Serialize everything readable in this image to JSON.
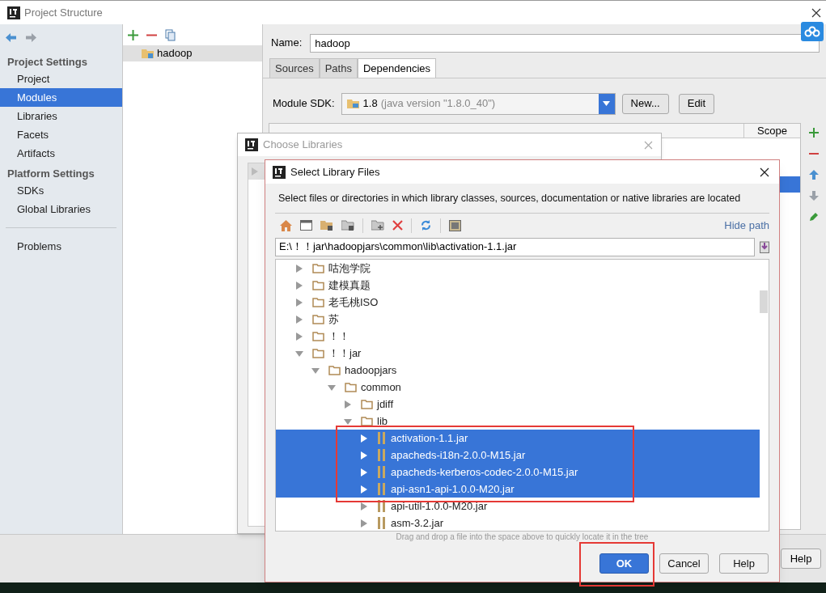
{
  "window": {
    "title": "Project Structure"
  },
  "sidebar": {
    "sections": [
      {
        "heading": "Project Settings",
        "items": [
          {
            "label": "Project",
            "selected": false
          },
          {
            "label": "Modules",
            "selected": true
          },
          {
            "label": "Libraries",
            "selected": false
          },
          {
            "label": "Facets",
            "selected": false
          },
          {
            "label": "Artifacts",
            "selected": false
          }
        ]
      },
      {
        "heading": "Platform Settings",
        "items": [
          {
            "label": "SDKs",
            "selected": false
          },
          {
            "label": "Global Libraries",
            "selected": false
          }
        ]
      }
    ],
    "footer_items": [
      {
        "label": "Problems",
        "selected": false
      }
    ]
  },
  "modules": {
    "items": [
      {
        "label": "hadoop",
        "selected": true
      }
    ]
  },
  "module_form": {
    "name_label": "Name:",
    "name_value": "hadoop",
    "tabs": [
      {
        "label": "Sources",
        "selected": false
      },
      {
        "label": "Paths",
        "selected": false
      },
      {
        "label": "Dependencies",
        "selected": true
      }
    ],
    "sdk_label": "Module SDK:",
    "sdk_value": "1.8",
    "sdk_detail": "(java version \"1.8.0_40\")",
    "buttons": [
      "New...",
      "Edit"
    ],
    "table": {
      "columns": [
        "Scope"
      ],
      "rows": [
        {
          "selected": true
        }
      ]
    }
  },
  "bottom_buttons": [
    "Help"
  ],
  "choose_dialog": {
    "title": "Choose Libraries"
  },
  "select_dialog": {
    "title": "Select Library Files",
    "description": "Select files or directories in which library classes, sources, documentation or native libraries are located",
    "hide_path": "Hide path",
    "path_value": "E:\\！！jar\\hadoopjars\\common\\lib\\activation-1.1.jar",
    "tree": [
      {
        "label": "咕泡学院",
        "kind": "folder",
        "expanded": false,
        "selected": false
      },
      {
        "label": "建模真题",
        "kind": "folder",
        "expanded": false,
        "selected": false
      },
      {
        "label": "老毛桃ISO",
        "kind": "folder",
        "expanded": false,
        "selected": false
      },
      {
        "label": "苏",
        "kind": "folder",
        "expanded": false,
        "selected": false
      },
      {
        "label": "！！",
        "kind": "folder",
        "expanded": false,
        "selected": false
      },
      {
        "label": "！！jar",
        "kind": "folder",
        "expanded": true,
        "selected": false,
        "children": [
          {
            "label": "hadoopjars",
            "kind": "folder",
            "expanded": true,
            "selected": false,
            "children": [
              {
                "label": "common",
                "kind": "folder",
                "expanded": true,
                "selected": false,
                "children": [
                  {
                    "label": "jdiff",
                    "kind": "folder",
                    "expanded": false,
                    "selected": false
                  },
                  {
                    "label": "lib",
                    "kind": "folder",
                    "expanded": true,
                    "selected": false,
                    "children": [
                      {
                        "label": "activation-1.1.jar",
                        "kind": "jar",
                        "expanded": false,
                        "selected": true
                      },
                      {
                        "label": "apacheds-i18n-2.0.0-M15.jar",
                        "kind": "jar",
                        "expanded": false,
                        "selected": true
                      },
                      {
                        "label": "apacheds-kerberos-codec-2.0.0-M15.jar",
                        "kind": "jar",
                        "expanded": false,
                        "selected": true
                      },
                      {
                        "label": "api-asn1-api-1.0.0-M20.jar",
                        "kind": "jar",
                        "expanded": false,
                        "selected": true
                      },
                      {
                        "label": "api-util-1.0.0-M20.jar",
                        "kind": "jar",
                        "expanded": false,
                        "selected": false
                      },
                      {
                        "label": "asm-3.2.jar",
                        "kind": "jar",
                        "expanded": false,
                        "selected": false
                      }
                    ]
                  }
                ]
              }
            ]
          }
        ]
      }
    ],
    "hint": "Drag and drop a file into the space above to quickly locate it in the tree",
    "buttons": [
      {
        "label": "OK",
        "kind": "primary"
      },
      {
        "label": "Cancel",
        "kind": "normal"
      },
      {
        "label": "Help",
        "kind": "normal"
      }
    ]
  }
}
